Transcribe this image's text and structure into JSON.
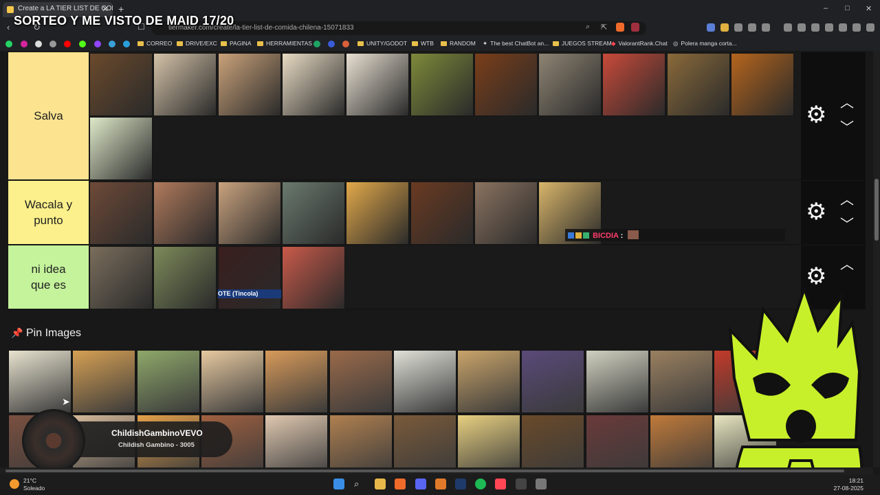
{
  "stream_title": "SORTEO Y ME VISTO DE MAID 17/20",
  "tab": {
    "title": "Create a LA TIER LIST DE COMIDA",
    "new_tab": "+",
    "close": "✕"
  },
  "window_controls": {
    "minimize": "–",
    "maximize": "□",
    "close": "✕"
  },
  "nav": {
    "back": "‹",
    "refresh": "↻",
    "url": "tiermaker.com/create/la-tier-list-de-comida-chilena-15071833"
  },
  "bookmarks": [
    "CORREO",
    "DRIVE/EXC",
    "PAGINA",
    "HERRAMIENTAS",
    "UNITY/GODOT",
    "WTB",
    "RANDOM",
    "The best ChatBot an...",
    "JUEGOS STREAM",
    "ValorantRank.Chat",
    "Polera manga corta..."
  ],
  "tiers": [
    {
      "label": "Salva",
      "color": "#fbe38f"
    },
    {
      "label": "Wacala y punto",
      "color": "#fbf08b"
    },
    {
      "label": "ni idea que es",
      "color": "#c5f39c"
    }
  ],
  "tile_overlay_text": "OTE (Tincola)",
  "pin_section": {
    "title": "Pin Images",
    "icon": "pushpin-icon"
  },
  "chat_overlay": {
    "user": "BICDIA",
    "sep": ":"
  },
  "music": {
    "track": "ChildishGambinoVEVO",
    "artist": "Childish Gambino - 3005"
  },
  "taskbar": {
    "temperature": "21°C",
    "weather": "Soleado",
    "time": "18:21",
    "date": "27-08-2025"
  },
  "tier_tiles": [
    [
      "#6b4a2c",
      "#d4c2a8",
      "#caa27a",
      "#e9dcc4",
      "#e8e0d2",
      "#7e8a3a",
      "#7a3e1a",
      "#8e8473",
      "#c84a3a",
      "#8a6a3a",
      "#b5651d",
      "#dfe9c9"
    ],
    [
      "#6e4a38",
      "#b07a5c",
      "#c9a27e",
      "#6a7a6e",
      "#e2a94a",
      "#6a3a22",
      "#8a7360",
      "#d8b56a"
    ],
    [
      "#7a6e5c",
      "#7d8a5a",
      "#3a1e1e",
      "#c95a4a"
    ]
  ],
  "pin_tiles": [
    [
      "#e8e3cf",
      "#d6a054",
      "#8fa86a",
      "#e7c9a0",
      "#d89a5a",
      "#9a6a4a",
      "#e0e0d8",
      "#c9a46a",
      "#5a4a7a",
      "#d0d0c0",
      "#9a8060",
      "#c23a2a"
    ],
    [
      "#7a5040",
      "#d4b89a",
      "#e4a04a",
      "#a06040",
      "#e0c8b0",
      "#b08050",
      "#7a5a3a",
      "#e8d080",
      "#6a4a2a",
      "#6a3a3a",
      "#c07a3a",
      "#e8e6c0"
    ]
  ]
}
